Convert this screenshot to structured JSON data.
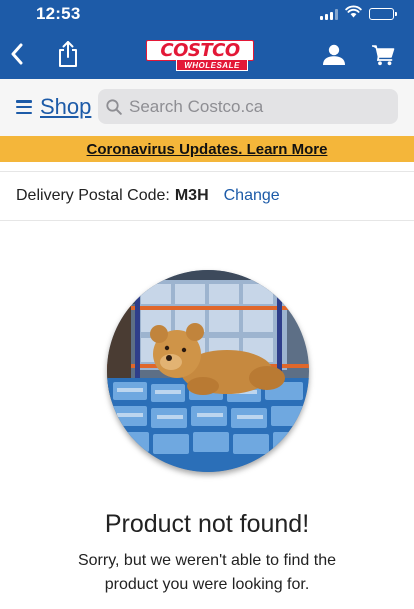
{
  "status_bar": {
    "time": "12:53"
  },
  "nav": {
    "logo_brand": "COSTCO",
    "logo_sub": "WHOLESALE"
  },
  "search": {
    "shop_label": "Shop",
    "placeholder": "Search Costco.ca"
  },
  "banner": {
    "text": "Coronavirus Updates. Learn More",
    "color": "#f4b63a"
  },
  "delivery": {
    "label": "Delivery Postal Code:",
    "postal_code": "M3H",
    "change_label": "Change"
  },
  "content": {
    "title": "Product not found!",
    "message": "Sorry, but we weren't able to find the product you were looking for."
  },
  "colors": {
    "brand_blue": "#1d5ba8",
    "brand_red": "#e31837"
  },
  "icons": [
    "back-chevron-icon",
    "share-icon",
    "account-icon",
    "cart-icon",
    "search-icon",
    "menu-icon"
  ]
}
